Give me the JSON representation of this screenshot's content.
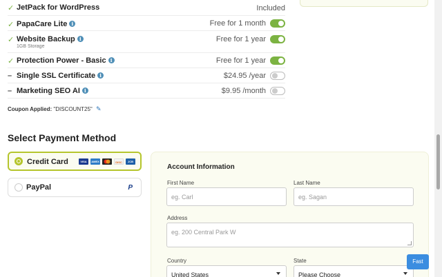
{
  "addons": [
    {
      "mark": "✓",
      "type": "check",
      "name": "JetPack for WordPress",
      "info": false,
      "sub": "",
      "price": "Included",
      "toggle": "none"
    },
    {
      "mark": "✓",
      "type": "check",
      "name": "PapaCare Lite",
      "info": true,
      "sub": "",
      "price": "Free for 1 month",
      "toggle": "on"
    },
    {
      "mark": "✓",
      "type": "check",
      "name": "Website Backup",
      "info": true,
      "sub": "1GB Storage",
      "price": "Free for 1 year",
      "toggle": "on"
    },
    {
      "mark": "✓",
      "type": "check",
      "name": "Protection Power - Basic",
      "info": true,
      "sub": "",
      "price": "Free for 1 year",
      "toggle": "on"
    },
    {
      "mark": "–",
      "type": "dash",
      "name": "Single SSL Certificate",
      "info": true,
      "sub": "",
      "price": "$24.95 /year",
      "toggle": "off"
    },
    {
      "mark": "–",
      "type": "dash",
      "name": "Marketing SEO AI",
      "info": true,
      "sub": "",
      "price": "$9.95 /month",
      "toggle": "off"
    }
  ],
  "coupon": {
    "label": "Coupon Applied:",
    "code": "\"DISCOUNT25\""
  },
  "payment": {
    "title": "Select Payment Method",
    "options": [
      {
        "label": "Credit Card",
        "selected": true
      },
      {
        "label": "PayPal",
        "selected": false
      }
    ],
    "card_logos": [
      "VISA",
      "AMEX",
      "MC",
      "DISC",
      "JCB"
    ]
  },
  "form": {
    "title": "Account Information",
    "first_name_label": "First Name",
    "first_name_placeholder": "eg. Carl",
    "last_name_label": "Last Name",
    "last_name_placeholder": "eg. Sagan",
    "address_label": "Address",
    "address_placeholder": "eg. 200 Central Park W",
    "country_label": "Country",
    "country_value": "United States",
    "state_label": "State",
    "state_value": "Please Choose"
  },
  "fast_button": "Fast",
  "colors": {
    "accent_green": "#7cb342",
    "selected_border": "#b5c52c",
    "info_blue": "#4f8fb7",
    "fast_blue": "#3b8de0"
  }
}
